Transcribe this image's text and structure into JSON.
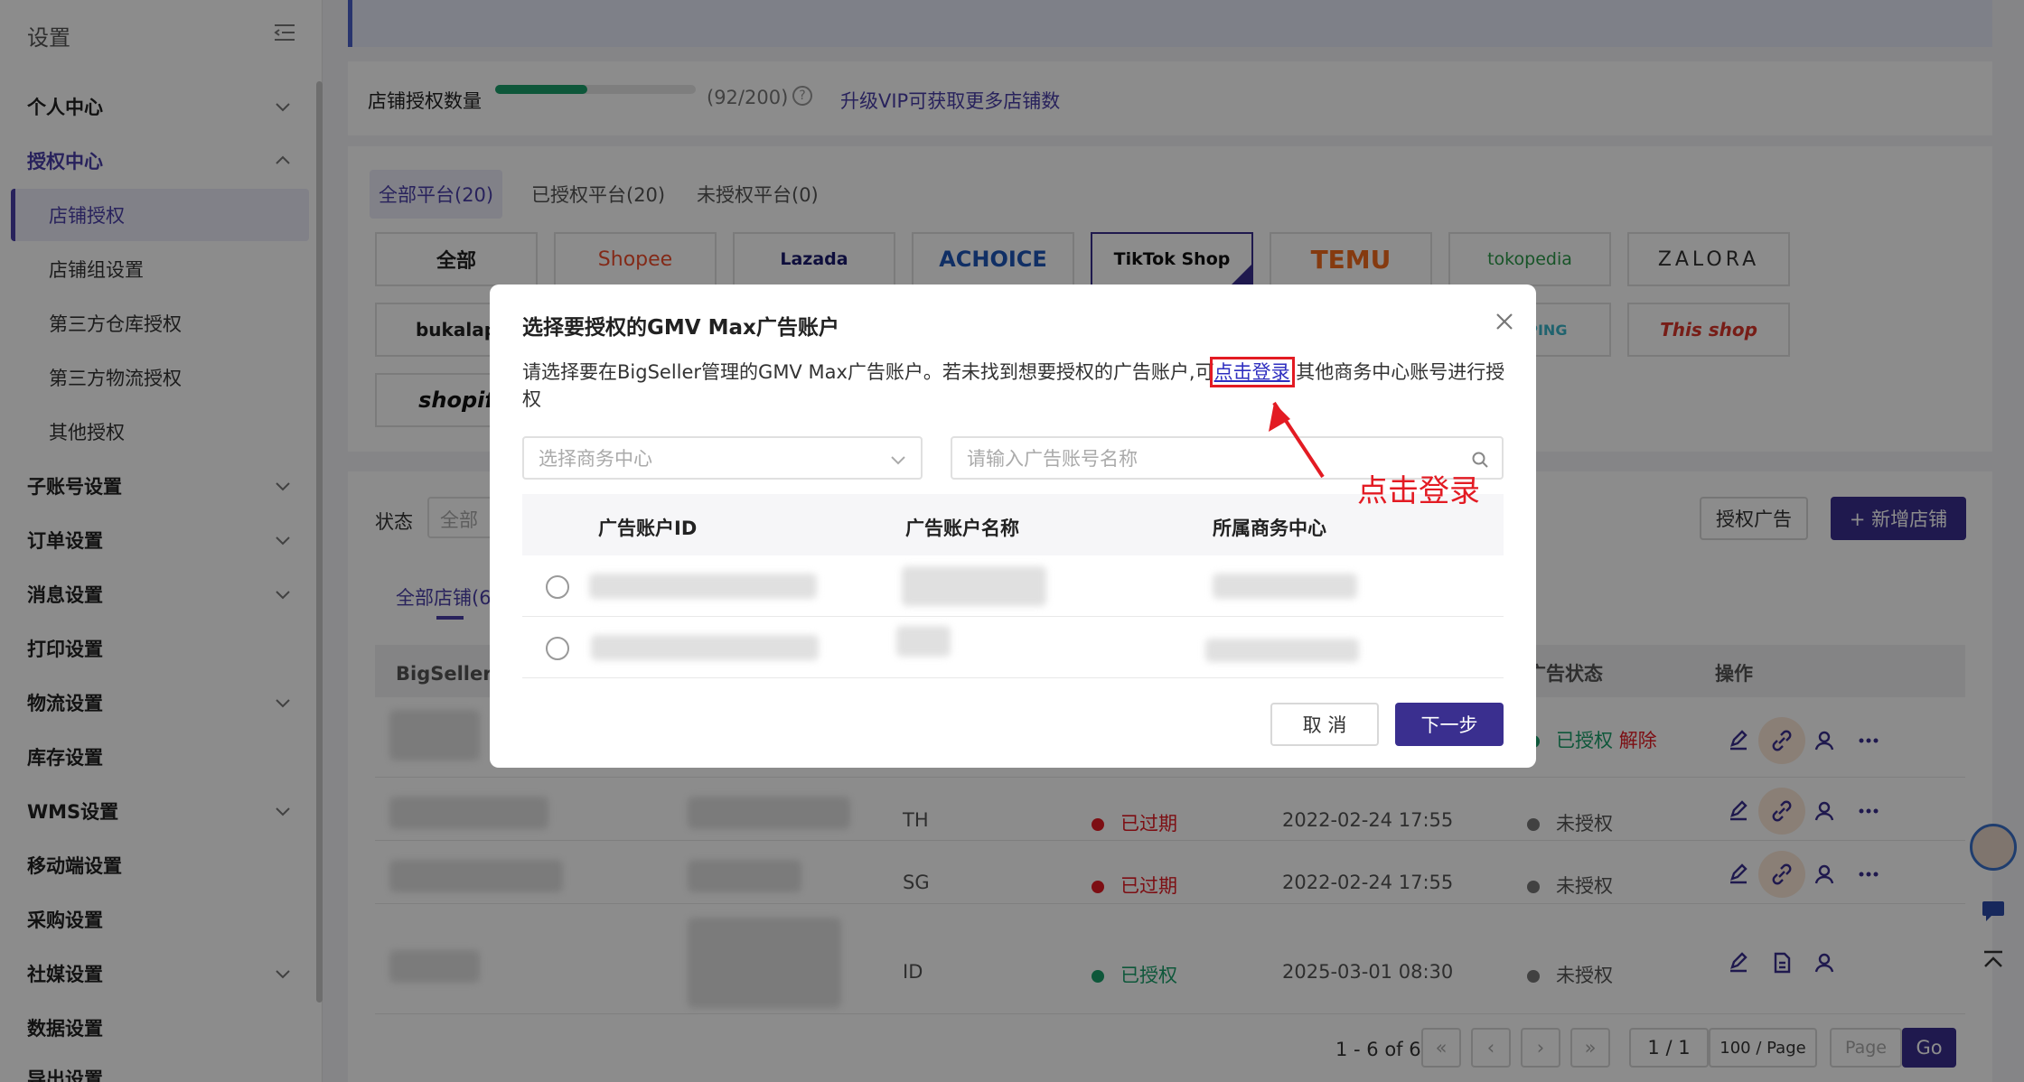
{
  "sidebar": {
    "title": "设置",
    "items": [
      {
        "label": "个人中心"
      },
      {
        "label": "授权中心"
      },
      {
        "label": "店铺授权"
      },
      {
        "label": "店铺组设置"
      },
      {
        "label": "第三方仓库授权"
      },
      {
        "label": "第三方物流授权"
      },
      {
        "label": "其他授权"
      },
      {
        "label": "子账号设置"
      },
      {
        "label": "订单设置"
      },
      {
        "label": "消息设置"
      },
      {
        "label": "打印设置"
      },
      {
        "label": "物流设置"
      },
      {
        "label": "库存设置"
      },
      {
        "label": "WMS设置"
      },
      {
        "label": "移动端设置"
      },
      {
        "label": "采购设置"
      },
      {
        "label": "社媒设置"
      },
      {
        "label": "数据设置"
      },
      {
        "label": "导出设置"
      }
    ]
  },
  "quota": {
    "label": "店铺授权数量",
    "progress": 0.46,
    "count_text": "(92/200)",
    "vip_link": "升级VIP可获取更多店铺数"
  },
  "platforms": {
    "tabs": [
      "全部平台(20)",
      "已授权平台(20)",
      "未授权平台(0)"
    ],
    "row1": [
      "全部",
      "Shopee",
      "Lazada",
      "ACHOICE",
      "TikTok Shop",
      "TEMU",
      "tokopedia",
      "ZALORA"
    ],
    "row2": [
      "bukalap",
      "HOPPING",
      "This shop"
    ],
    "row3": [
      "shopif"
    ]
  },
  "shops": {
    "filter_label": "状态",
    "filter_value": "全部",
    "authorize_ads_btn": "授权广告",
    "add_shop_btn": "+ 新增店铺",
    "tab_all": "全部店铺(6",
    "columns": [
      "BigSeller 店",
      "广告状态",
      "操作"
    ],
    "rows": [
      {
        "site": "",
        "status": "",
        "date": "",
        "ad_status": "已授权",
        "unbind": "解除"
      },
      {
        "site": "TH",
        "status": "已过期",
        "date": "2022-02-24 17:55",
        "ad_status": "未授权"
      },
      {
        "site": "SG",
        "status": "已过期",
        "date": "2022-02-24 17:55",
        "ad_status": "未授权"
      },
      {
        "site": "ID",
        "status": "已授权",
        "date": "2025-03-01 08:30",
        "ad_status": "未授权"
      }
    ],
    "pagination": {
      "range": "1 - 6 of 6",
      "page": "1 / 1",
      "page_size": "100 / Page",
      "page_placeholder": "Page",
      "go": "Go"
    }
  },
  "modal": {
    "title": "选择要授权的GMV Max广告账户",
    "desc_before": "请选择要在BigSeller管理的GMV Max广告账户。若未找到想要授权的广告账户,可",
    "desc_link": "点击登录",
    "desc_after": "其他商务中心账号进行授权",
    "select_placeholder": "选择商务中心",
    "search_placeholder": "请输入广告账号名称",
    "columns": [
      "广告账户ID",
      "广告账户名称",
      "所属商务中心"
    ],
    "cancel": "取 消",
    "next": "下一步"
  },
  "annotation": {
    "text": "点击登录"
  },
  "colors": {
    "primary": "#3a2f8f",
    "success": "#1a9e6a",
    "danger": "#e31b23",
    "link": "#4a3ea8"
  }
}
